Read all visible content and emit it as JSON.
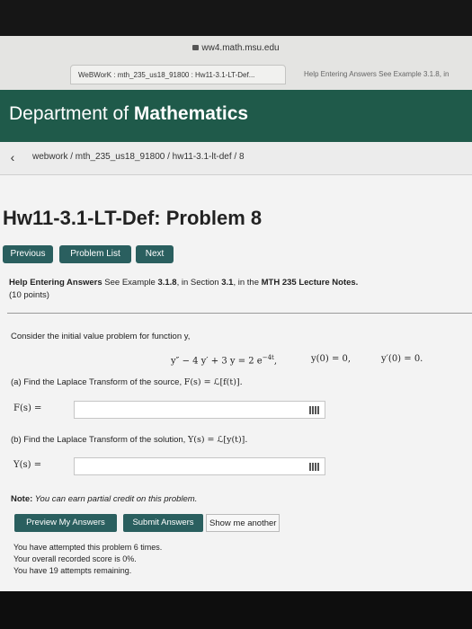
{
  "browser": {
    "url": "ww4.math.msu.edu",
    "active_tab": "WeBWorK : mth_235_us18_91800 : Hw11-3.1-LT-Def...",
    "inactive_tab": "Help Entering Answers See Example 3.1.8, in"
  },
  "header": {
    "dept_prefix": "Department of ",
    "dept_bold": "Mathematics"
  },
  "breadcrumb": {
    "back_icon": "chevron-left-icon",
    "text": "webwork / mth_235_us18_91800 / hw11-3.1-lt-def / 8"
  },
  "problem": {
    "title": "Hw11-3.1-LT-Def: Problem 8",
    "nav": [
      "Previous",
      "Problem List",
      "Next"
    ],
    "help_bold": "Help Entering Answers",
    "help_rest_1": " See Example ",
    "help_ex": "3.1.8",
    "help_rest_2": ", in Section ",
    "help_sec": "3.1",
    "help_rest_3": ", in the ",
    "help_course": "MTH 235 Lecture Notes.",
    "points": "(10 points)",
    "intro": "Consider the initial value problem for function y,",
    "ode": "y″ − 4 y′ + 3 y = 2 e",
    "ode_exp": "−4t",
    "ic1": "y(0) = 0,",
    "ic2": "y′(0) = 0.",
    "part_a": "(a) Find the Laplace Transform of the source, ",
    "part_a_math": "F(s) = ℒ[f(t)].",
    "label_a": "F(s) =",
    "part_b": "(b) Find the Laplace Transform of the solution, ",
    "part_b_math": "Y(s) = ℒ[y(t)].",
    "label_b": "Y(s) =",
    "answer_a": "",
    "answer_b": "",
    "note_bold": "Note:",
    "note_text": " You can earn partial credit on this problem.",
    "buttons": [
      "Preview My Answers",
      "Submit Answers",
      "Show me another"
    ],
    "status": [
      "You have attempted this problem 6 times.",
      "Your overall recorded score is 0%.",
      "You have 19 attempts remaining."
    ]
  },
  "colors": {
    "header": "#1f5a4a",
    "button": "#2a5f5f"
  }
}
